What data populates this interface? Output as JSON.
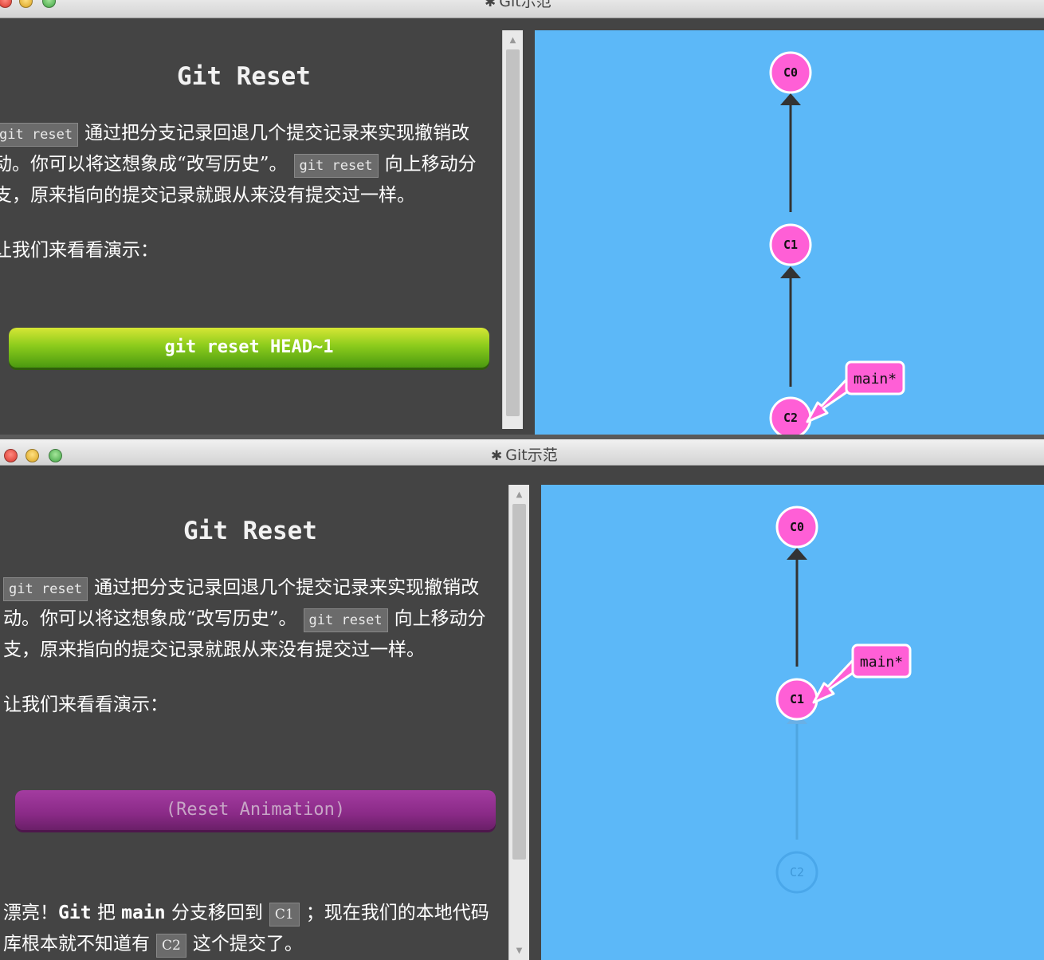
{
  "window_title": "Git示范",
  "windows": [
    {
      "heading": "Git Reset",
      "para1_code1": "git reset",
      "para1_text1": "通过把分支记录回退几个提交记录来实现撤销改动。你可以将这想象成“改写历史”。",
      "para1_code2": "git reset",
      "para1_text2": "向上移动分支，原来指向的提交记录就跟从来没有提交过一样。",
      "para2": "让我们来看看演示：",
      "button_label": "git reset HEAD~1",
      "branch_label": "main*",
      "nodes": [
        "C0",
        "C1",
        "C2"
      ]
    },
    {
      "heading": "Git Reset",
      "para1_code1": "git reset",
      "para1_text1": "通过把分支记录回退几个提交记录来实现撤销改动。你可以将这想象成“改写历史”。",
      "para1_code2": "git reset",
      "para1_text2": "向上移动分支，原来指向的提交记录就跟从来没有提交过一样。",
      "para2": "让我们来看看演示：",
      "button_label": "(Reset Animation)",
      "result_prefix": "漂亮！",
      "result_git": "Git",
      "result_ba": "把",
      "result_main": "main",
      "result_mid": "分支移回到",
      "result_code1": "C1",
      "result_after": "；现在我们的本地代码库根本就不知道有",
      "result_code2": "C2",
      "result_end": "这个提交了。",
      "branch_label": "main*",
      "nodes": [
        "C0",
        "C1",
        "C2"
      ]
    }
  ],
  "colors": {
    "viz_bg": "#5cb8f8",
    "node_fill": "#ff5fd6",
    "branch_fill": "#ff5fd6",
    "edge": "#333333"
  }
}
